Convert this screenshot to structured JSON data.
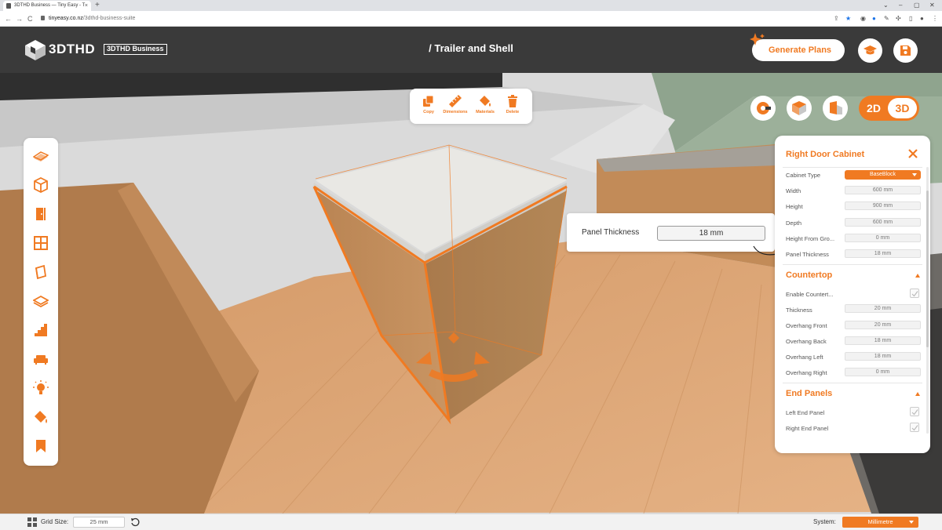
{
  "browser": {
    "tab_title": "3DTHD Business — Tiny Easy - T",
    "tab_close": "×",
    "new_tab": "+",
    "url_host": "tinyeasy.co.nz",
    "url_path": "/3dthd-business-suite",
    "nav_back": "←",
    "nav_forward": "→",
    "nav_reload": "C"
  },
  "header": {
    "logo_text": "3DTHD",
    "badge": "3DTHD Business",
    "project_title": "/ Trailer and Shell",
    "generate_label": "Generate Plans"
  },
  "toolbar": {
    "copy": "Copy",
    "dimensions": "Dimensions",
    "materials": "Materials",
    "delete": "Delete"
  },
  "view": {
    "label_2d": "2D",
    "label_3d": "3D",
    "active": "3D"
  },
  "sidebar": {
    "items": [
      {
        "icon": "trailer-icon"
      },
      {
        "icon": "shell-cube-icon"
      },
      {
        "icon": "door-icon"
      },
      {
        "icon": "window-icon"
      },
      {
        "icon": "wall-panel-icon"
      },
      {
        "icon": "floor-icon"
      },
      {
        "icon": "stairs-icon"
      },
      {
        "icon": "sofa-icon"
      },
      {
        "icon": "lighting-icon"
      },
      {
        "icon": "paint-bucket-icon"
      },
      {
        "icon": "bookmark-icon"
      }
    ]
  },
  "popup": {
    "label": "Panel Thickness",
    "value": "18 mm"
  },
  "props": {
    "title": "Right Door Cabinet",
    "rows": [
      {
        "label": "Cabinet Type",
        "value": "BaseBlock",
        "kind": "select"
      },
      {
        "label": "Width",
        "value": "600 mm"
      },
      {
        "label": "Height",
        "value": "900 mm"
      },
      {
        "label": "Depth",
        "value": "600 mm"
      },
      {
        "label": "Height From Gro...",
        "value": "0 mm"
      },
      {
        "label": "Panel Thickness",
        "value": "18 mm"
      }
    ],
    "countertop": {
      "title": "Countertop",
      "enable_label": "Enable Countert...",
      "enable_checked": true,
      "rows": [
        {
          "label": "Thickness",
          "value": "20 mm"
        },
        {
          "label": "Overhang Front",
          "value": "20 mm"
        },
        {
          "label": "Overhang Back",
          "value": "18 mm"
        },
        {
          "label": "Overhang Left",
          "value": "18 mm"
        },
        {
          "label": "Overhang Right",
          "value": "0 mm"
        }
      ]
    },
    "end_panels": {
      "title": "End Panels",
      "left_label": "Left End Panel",
      "left_checked": true,
      "right_label": "Right End Panel",
      "right_checked": true
    }
  },
  "bottom": {
    "grid_label": "Grid Size:",
    "grid_value": "25 mm",
    "system_label": "System:",
    "system_value": "Millimetre"
  },
  "colors": {
    "accent": "#f07a22",
    "header_bg": "#3a3a3a",
    "wood": "#c9935e",
    "floor": "#dca275"
  }
}
